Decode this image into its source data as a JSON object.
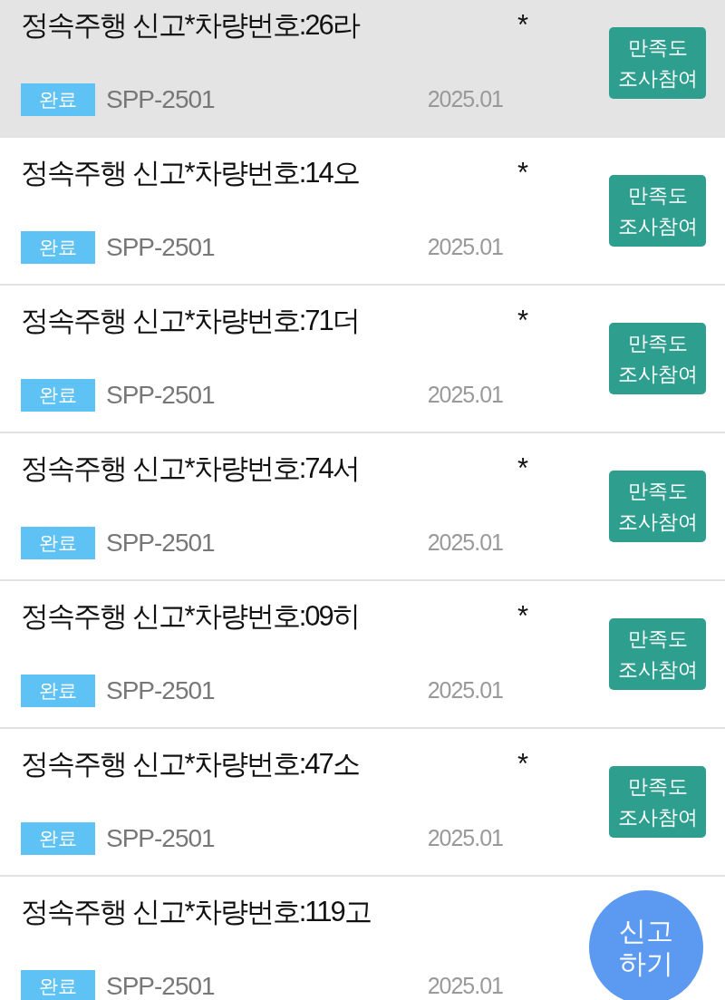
{
  "reports": [
    {
      "title": "정속주행 신고*차량번호:26라",
      "trailing_mark": "*",
      "status": "완료",
      "report_id": "SPP-2501",
      "date": "2025.01",
      "survey_button": "만족도 조사참여",
      "selected": true
    },
    {
      "title": "정속주행 신고*차량번호:14오",
      "trailing_mark": "*",
      "status": "완료",
      "report_id": "SPP-2501",
      "date": "2025.01",
      "survey_button": "만족도 조사참여",
      "selected": false
    },
    {
      "title": "정속주행 신고*차량번호:71더",
      "trailing_mark": "*",
      "status": "완료",
      "report_id": "SPP-2501",
      "date": "2025.01",
      "survey_button": "만족도 조사참여",
      "selected": false
    },
    {
      "title": "정속주행 신고*차량번호:74서",
      "trailing_mark": "*",
      "status": "완료",
      "report_id": "SPP-2501",
      "date": "2025.01",
      "survey_button": "만족도 조사참여",
      "selected": false
    },
    {
      "title": "정속주행 신고*차량번호:09히",
      "trailing_mark": "*",
      "status": "완료",
      "report_id": "SPP-2501",
      "date": "2025.01",
      "survey_button": "만족도 조사참여",
      "selected": false
    },
    {
      "title": "정속주행 신고*차량번호:47소",
      "trailing_mark": "*",
      "status": "완료",
      "report_id": "SPP-2501",
      "date": "2025.01",
      "survey_button": "만족도 조사참여",
      "selected": false
    },
    {
      "title": "정속주행 신고*차량번호:119고",
      "status": "완료",
      "report_id": "SPP-2501",
      "date": "2025.01",
      "selected": false
    }
  ],
  "fab": {
    "label": "신고 하기"
  }
}
